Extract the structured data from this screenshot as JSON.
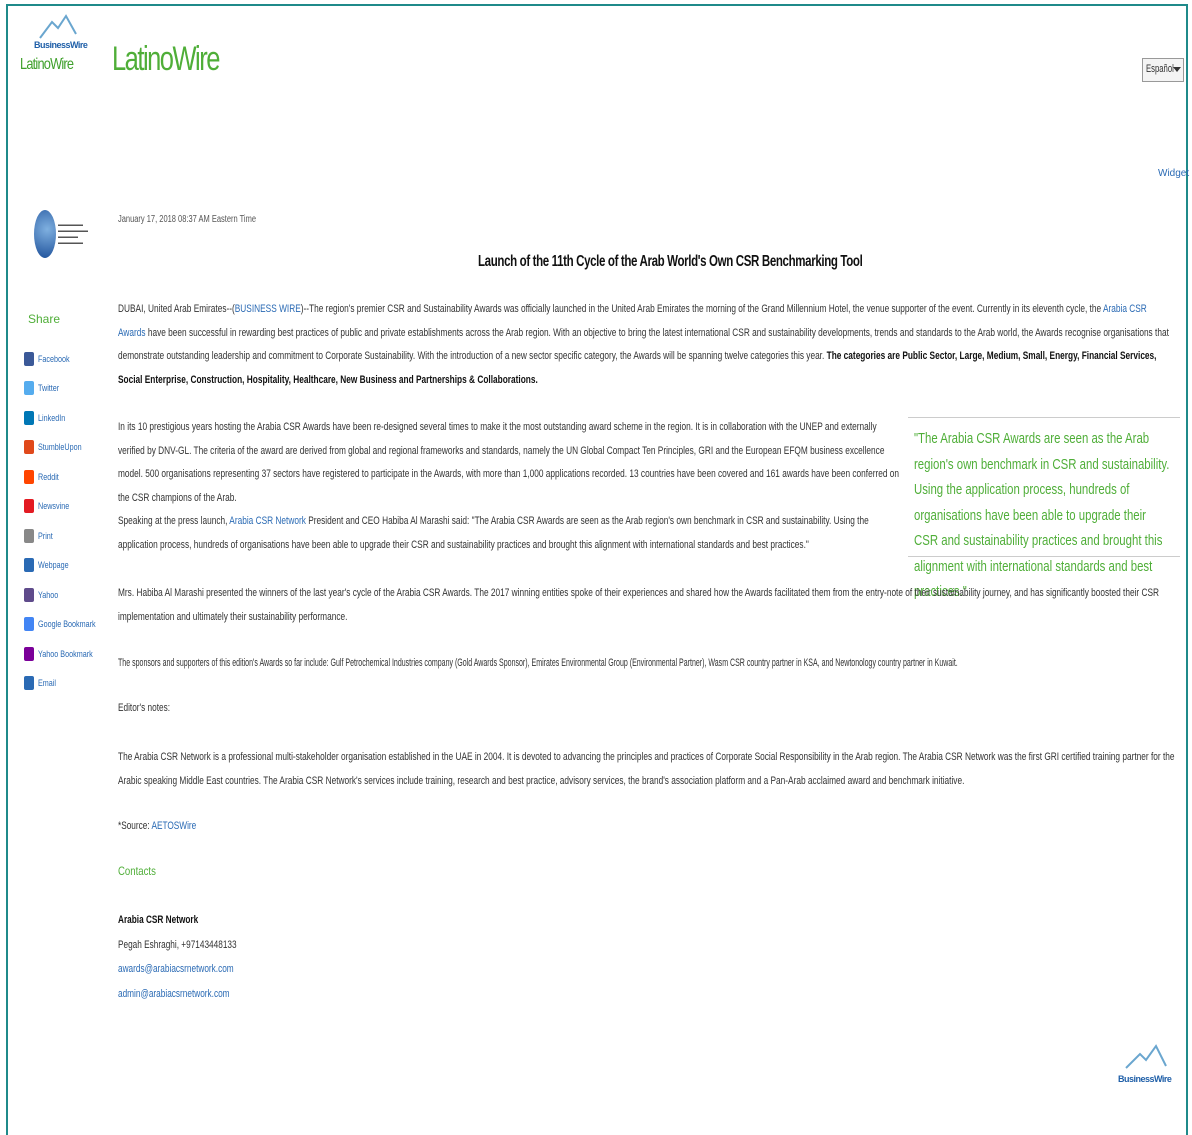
{
  "header": {
    "bw_logo_text": "BusinessWire",
    "bw_logo_sub": "LatinoWire",
    "title": "LatinoWire",
    "language": "Español",
    "top_link": "Widget"
  },
  "sidebar": {
    "share_label": "Share",
    "items": [
      {
        "label": "Facebook",
        "color": "#3b5998"
      },
      {
        "label": "Twitter",
        "color": "#55acee"
      },
      {
        "label": "LinkedIn",
        "color": "#0077b5"
      },
      {
        "label": "StumbleUpon",
        "color": "#e0491b"
      },
      {
        "label": "Reddit",
        "color": "#ff4500"
      },
      {
        "label": "Newsvine",
        "color": "#e31b23"
      },
      {
        "label": "Print",
        "color": "#888888"
      },
      {
        "label": "Webpage",
        "color": "#2a6ab4"
      },
      {
        "label": "Yahoo",
        "color": "#5f4b8b"
      },
      {
        "label": "Google Bookmark",
        "color": "#4285f4"
      },
      {
        "label": "Yahoo Bookmark",
        "color": "#7b0099"
      },
      {
        "label": "Email",
        "color": "#2a6ab4"
      }
    ]
  },
  "article": {
    "dateline": "January 17, 2018 08:37 AM Eastern Time",
    "headline": "Launch of the 11th Cycle of the Arab World's Own CSR Benchmarking Tool",
    "p1_a": "DUBAI, United Arab Emirates--(",
    "p1_link": "BUSINESS WIRE",
    "p1_b": ")--The region's premier CSR and Sustainability Awards was officially launched in the United Arab Emirates the morning of the Grand Millennium Hotel, the venue supporter of the event. Currently in its eleventh cycle, the ",
    "p1_link2": "Arabia CSR Awards",
    "p1_c": " have been successful in rewarding best practices of public and private establishments across the Arab region. With an objective to bring the latest international CSR and sustainability developments, trends and standards to the Arab world, the Awards recognise organisations that demonstrate outstanding leadership and commitment to Corporate Sustainability. With the introduction of a new sector specific category, the Awards will be spanning twelve categories this year. ",
    "p1_bold": "The categories are Public Sector, Large, Medium, Small, Energy, Financial Services, Social Enterprise, Construction, Hospitality, Healthcare, New Business and Partnerships & Collaborations.",
    "p2": "In its 10 prestigious years hosting the Arabia CSR Awards have been re-designed several times to make it the most outstanding award scheme in the region. It is in collaboration with the UNEP and externally verified by DNV-GL. The criteria of the award are derived from global and regional frameworks and standards, namely the UN Global Compact Ten Principles, GRI and the European EFQM business excellence model. 500 organisations representing 37 sectors have registered to participate in the Awards, with more than 1,000 applications recorded. 13 countries have been covered and 161 awards have been conferred on the CSR champions of the Arab.",
    "p3_a": "Speaking at the press launch, ",
    "p3_link": "Arabia CSR Network",
    "p3_b": " President and CEO Habiba Al Marashi said: \"The Arabia CSR Awards are seen as the Arab region's own benchmark in CSR and sustainability. Using the application process, hundreds of organisations have been able to upgrade their CSR and sustainability practices and brought this alignment with international standards and best practices.\"",
    "quote": "\"The Arabia CSR Awards are seen as the Arab region's own benchmark in CSR and sustainability. Using the application process, hundreds of organisations have been able to upgrade their CSR and sustainability practices and brought this alignment with international standards and best practices.\"",
    "p4": "Mrs. Habiba Al Marashi presented the winners of the last year's cycle of the Arabia CSR Awards. The 2017 winning entities spoke of their experiences and shared how the Awards facilitated them from the entry-note of their sustainability journey, and has significantly boosted their CSR implementation and ultimately their sustainability performance.",
    "p5": "The sponsors and supporters of this edition's Awards so far include: Gulf Petrochemical Industries company (Gold Awards Sponsor), Emirates Environmental Group (Environmental Partner), Wasm CSR country partner in KSA, and Newtonology country partner in Kuwait.",
    "editors": "Editor's notes:",
    "p6": "The Arabia CSR Network is a professional multi-stakeholder organisation established in the UAE in 2004. It is devoted to advancing the principles and practices of Corporate Social Responsibility in the Arab region. The Arabia CSR Network was the first GRI certified training partner for the Arabic speaking Middle East countries. The Arabia CSR Network's services include training, research and best practice, advisory services, the brand's association platform and a Pan-Arab acclaimed award and benchmark initiative.",
    "source_a": "*Source: ",
    "source_link": "AETOSWire",
    "contacts": "Contacts",
    "contact_name": "Arabia CSR Network",
    "contact_phone": "Pegah Eshraghi, +97143448133",
    "contact_email1": "awards@arabiacsrnetwork.com",
    "contact_email2": "admin@arabiacsrnetwork.com"
  },
  "footer": {
    "logo_text": "BusinessWire"
  },
  "colors": {
    "frame": "#1f8a8a",
    "brand_green": "#4fae38",
    "link": "#2a6ab4"
  }
}
